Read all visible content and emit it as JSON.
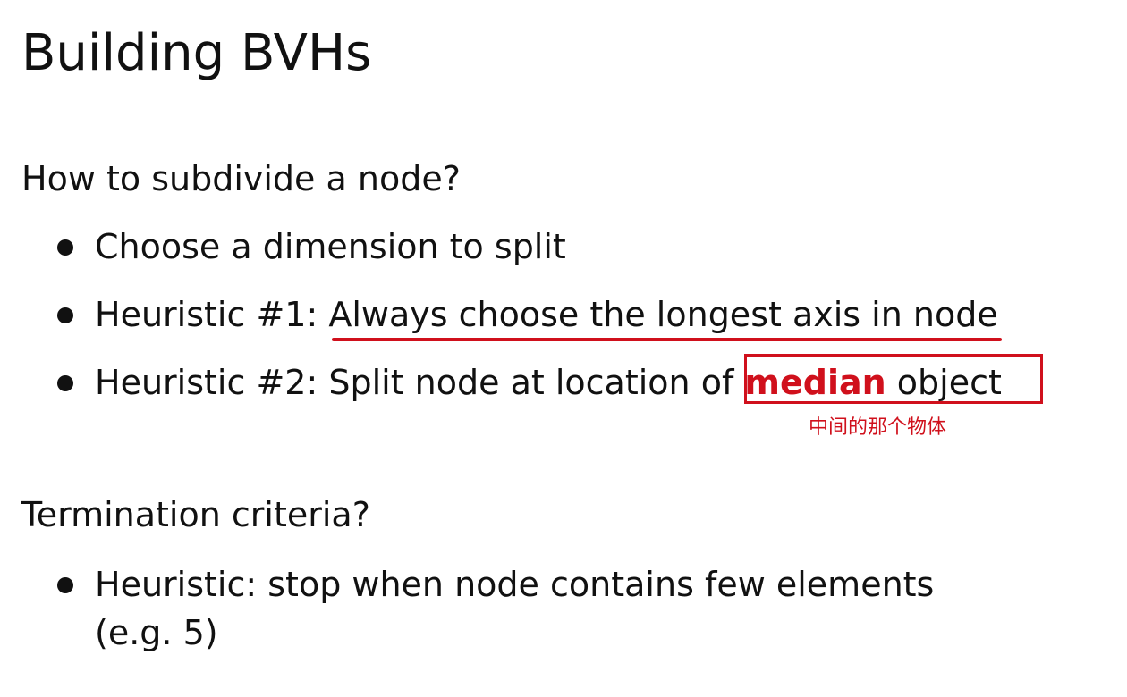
{
  "slide": {
    "title": "Building BVHs"
  },
  "subdivide": {
    "heading": "How to subdivide a node?",
    "bullet_1": "Choose a dimension to split",
    "bullet_2_prefix": "Heuristic #1: ",
    "bullet_2_underlined": "Always choose the longest axis in node",
    "bullet_3_prefix": "Heuristic #2: Split node at location of ",
    "bullet_3_highlight": "median",
    "bullet_3_suffix": " object",
    "annotation": "中间的那个物体"
  },
  "termination": {
    "heading": "Termination criteria?",
    "bullet_1_line1": "Heuristic: stop when node contains few elements",
    "bullet_1_line2": "(e.g. 5)"
  },
  "colors": {
    "annotation_red": "#d0101c",
    "text": "#111111",
    "background": "#ffffff"
  }
}
